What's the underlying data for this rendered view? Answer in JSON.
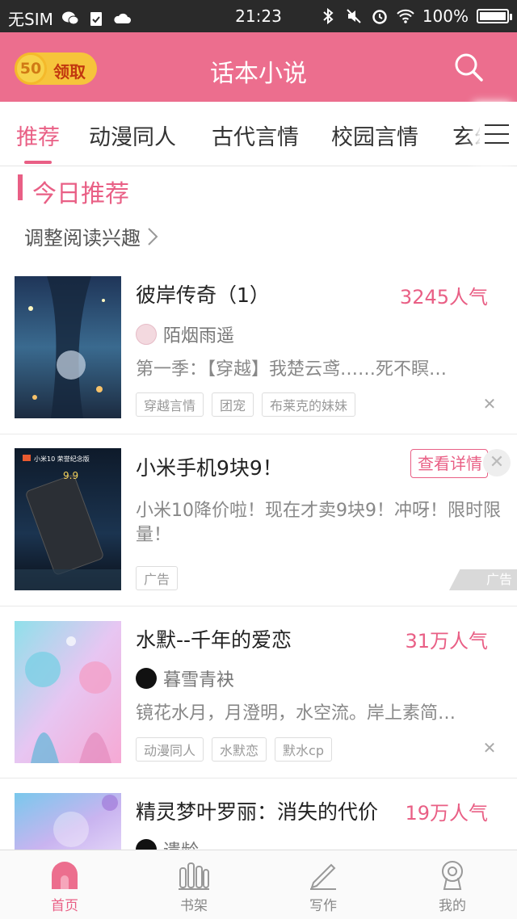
{
  "status_bar": {
    "carrier": "无SIM",
    "time": "21:23",
    "battery": "100%",
    "battery_level": 1.0
  },
  "header": {
    "coin_value": "50",
    "coin_label": "领取",
    "title": "话本小说"
  },
  "tabs": [
    {
      "label": "推荐",
      "active": true
    },
    {
      "label": "动漫同人"
    },
    {
      "label": "古代言情"
    },
    {
      "label": "校园言情"
    },
    {
      "label": "玄幻"
    }
  ],
  "section": {
    "title": "今日推荐",
    "adjust_label": "调整阅读兴趣"
  },
  "items": [
    {
      "title": "彼岸传奇（1）",
      "popularity": "3245人气",
      "author": "陌烟雨遥",
      "description": "第一季：【穿越】我楚云鸢……死不瞑…",
      "tags": [
        "穿越言情",
        "团宠",
        "布莱克的妹妹"
      ]
    },
    {
      "title": "小米手机9块9！",
      "ad_button": "查看详情",
      "description": "小米10降价啦！现在才卖9块9！冲呀！限时限量！",
      "tags": [
        "广告"
      ],
      "ad_mark": "广告",
      "cover_text": "小米10 荣誉纪念版",
      "cover_price": "9.9"
    },
    {
      "title": "水默--千年的爱恋",
      "popularity": "31万人气",
      "author": "暮雪青袂",
      "description": "镜花水月，月澄明，水空流。岸上素简…",
      "tags": [
        "动漫同人",
        "水默恋",
        "默水cp"
      ]
    },
    {
      "title": "精灵梦叶罗丽：消失的代价",
      "popularity": "19万人气",
      "author": "遗龄"
    }
  ],
  "bottom_nav": [
    {
      "label": "首页",
      "icon": "home-icon",
      "active": true
    },
    {
      "label": "书架",
      "icon": "bookshelf-icon"
    },
    {
      "label": "写作",
      "icon": "pen-icon"
    },
    {
      "label": "我的",
      "icon": "profile-icon"
    }
  ],
  "colors": {
    "accent": "#e95f85",
    "header_bg": "#ec6e8e",
    "coin": "#f6c43b"
  }
}
